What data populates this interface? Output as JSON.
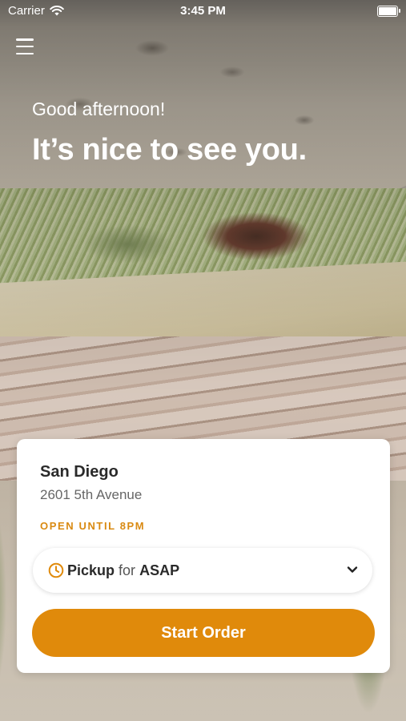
{
  "status_bar": {
    "carrier": "Carrier",
    "time": "3:45 PM",
    "wifi_icon": "wifi-icon",
    "battery_level": 1.0
  },
  "header": {
    "menu_icon": "hamburger-menu-icon",
    "greeting": "Good afternoon!",
    "headline": "It’s nice to see you."
  },
  "store": {
    "name": "San Diego",
    "address": "2601 5th Avenue",
    "hours": "OPEN UNTIL 8PM"
  },
  "order_mode": {
    "icon": "clock-icon",
    "mode": "Pickup",
    "connector": "for",
    "time": "ASAP",
    "dropdown_icon": "chevron-down-icon"
  },
  "actions": {
    "start_order": "Start Order"
  },
  "colors": {
    "accent": "#e08a0b",
    "hours_text": "#d98a12"
  }
}
